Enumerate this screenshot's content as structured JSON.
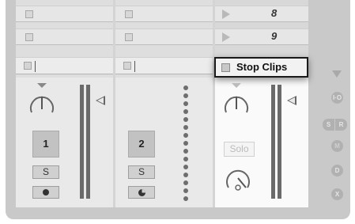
{
  "session": {
    "scenes": [
      {
        "track3_number": "8"
      },
      {
        "track3_number": "9"
      }
    ],
    "stop_clips_label": "Stop Clips"
  },
  "tracks": [
    {
      "number": "1",
      "solo_label": "S"
    },
    {
      "number": "2",
      "solo_label": "S"
    },
    {
      "solo_label": "Solo"
    }
  ],
  "side_buttons": {
    "io": "I·O",
    "sends": "S",
    "returns": "R",
    "mixer": "M",
    "delay": "D",
    "crossfader": "X"
  }
}
